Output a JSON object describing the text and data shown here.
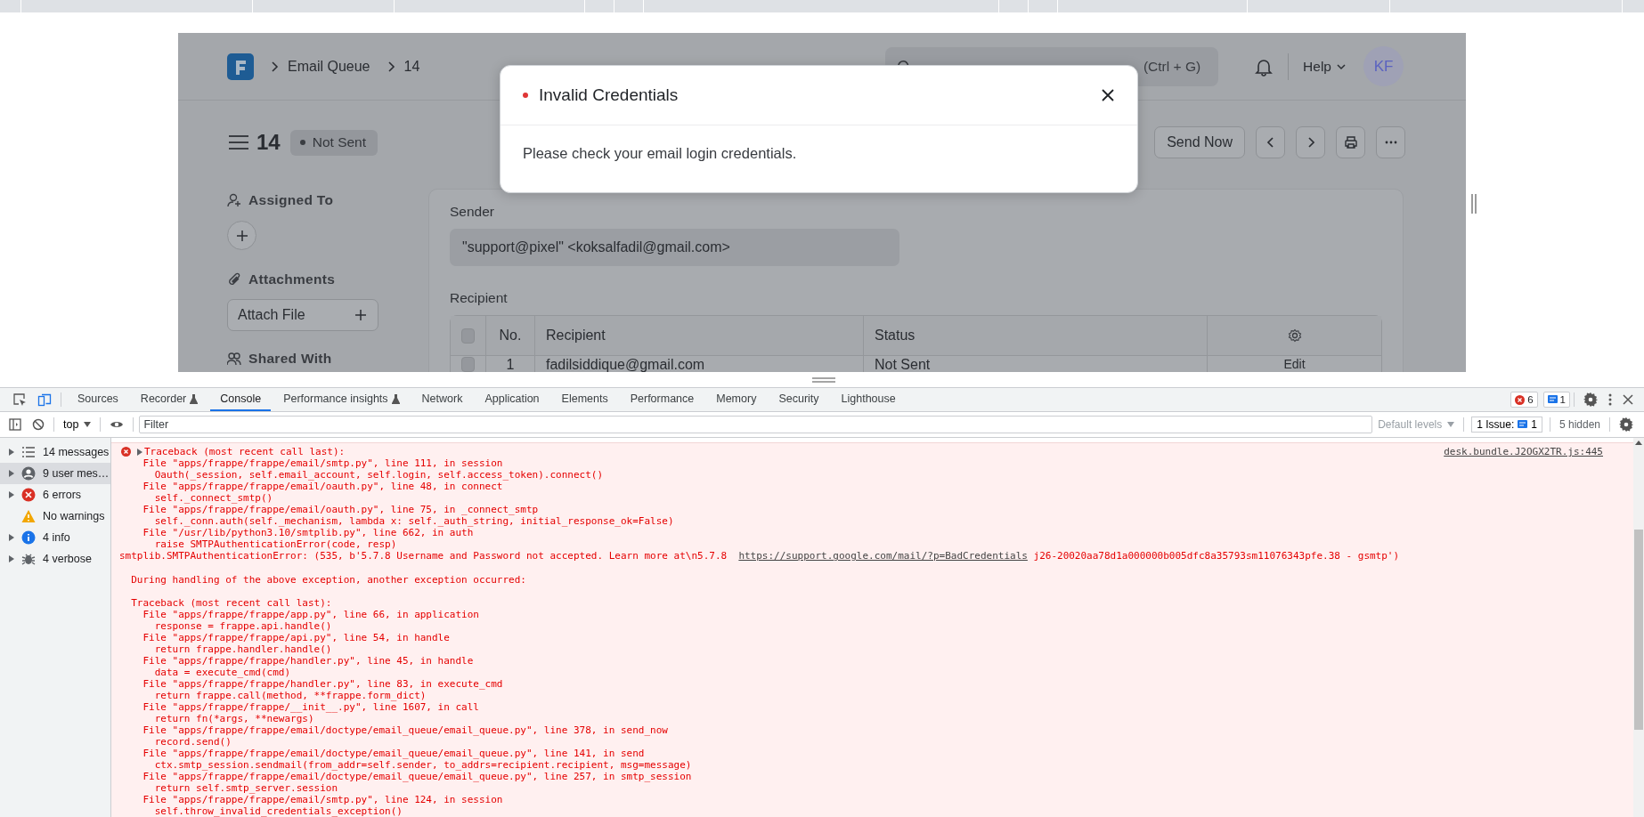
{
  "app": {
    "breadcrumbs": [
      "Email Queue",
      "14"
    ],
    "search": {
      "placeholder": "(Ctrl + G)"
    },
    "help": "Help",
    "avatar": "KF",
    "doc": {
      "title": "14",
      "status": "Not Sent"
    },
    "send_button": "Send Now",
    "sidebar": [
      {
        "kind": "assign",
        "label": "Assigned To"
      },
      {
        "kind": "attach",
        "label": "Attachments",
        "button": "Attach File"
      },
      {
        "kind": "share",
        "label": "Shared With"
      }
    ],
    "form": {
      "sender_label": "Sender",
      "sender_value": "\"support@pixel\" <koksalfadil@gmail.com>",
      "recipient_label": "Recipient",
      "table": {
        "select_all_checked": false,
        "columns": [
          "No.",
          "Recipient",
          "Status"
        ],
        "rows": [
          {
            "checked": false,
            "cells": [
              "1",
              "fadilsiddique@gmail.com",
              "Not Sent"
            ],
            "action": "Edit"
          }
        ]
      }
    }
  },
  "dialog": {
    "title": "Invalid Credentials",
    "message": "Please check your email login credentials."
  },
  "devtools": {
    "tabs": [
      {
        "label": "Sources",
        "selected": false,
        "experimental": false
      },
      {
        "label": "Recorder",
        "selected": false,
        "experimental": true
      },
      {
        "label": "Console",
        "selected": true,
        "experimental": false
      },
      {
        "label": "Performance insights",
        "selected": false,
        "experimental": true
      },
      {
        "label": "Network",
        "selected": false,
        "experimental": false
      },
      {
        "label": "Application",
        "selected": false,
        "experimental": false
      },
      {
        "label": "Elements",
        "selected": false,
        "experimental": false
      },
      {
        "label": "Performance",
        "selected": false,
        "experimental": false
      },
      {
        "label": "Memory",
        "selected": false,
        "experimental": false
      },
      {
        "label": "Security",
        "selected": false,
        "experimental": false
      },
      {
        "label": "Lighthouse",
        "selected": false,
        "experimental": false
      }
    ],
    "error_count": "6",
    "message_count": "1",
    "context": "top",
    "filter": {
      "placeholder": "Filter"
    },
    "levels": "Default levels",
    "issues": {
      "label": "1 Issue:",
      "count": "1"
    },
    "hidden": "5 hidden",
    "sidebar": [
      {
        "kind": "messages",
        "label": "14 messages",
        "selected": false
      },
      {
        "kind": "user",
        "label": "9 user mes…",
        "selected": true
      },
      {
        "kind": "errors",
        "label": "6 errors",
        "selected": false
      },
      {
        "kind": "warnings",
        "label": "No warnings",
        "selected": false
      },
      {
        "kind": "info",
        "label": "4 info",
        "selected": false
      },
      {
        "kind": "verbose",
        "label": "4 verbose",
        "selected": false
      }
    ],
    "message": {
      "source": "desk.bundle.J2OGX2TR.js:445",
      "sections": [
        [
          "Traceback (most recent call last):",
          "    File \"apps/frappe/frappe/email/smtp.py\", line 111, in session",
          "      Oauth(_session, self.email_account, self.login, self.access_token).connect()",
          "    File \"apps/frappe/frappe/email/oauth.py\", line 48, in connect",
          "      self._connect_smtp()",
          "    File \"apps/frappe/frappe/email/oauth.py\", line 75, in _connect_smtp",
          "      self._conn.auth(self._mechanism, lambda x: self._auth_string, initial_response_ok=False)",
          "    File \"/usr/lib/python3.10/smtplib.py\", line 662, in auth",
          "      raise SMTPAuthenticationError(code, resp)",
          {
            "text": "smtplib.SMTPAuthenticationError: (535, b'5.7.8 Username and Password not accepted. Learn more at\\n5.7.8  ",
            "link": "https://support.google.com/mail/?p=BadCredentials",
            "after": " j26-20020aa78d1a000000b005dfc8a35793sm11076343pfe.38 - gsmtp')"
          }
        ],
        [
          "  During handling of the above exception, another exception occurred:"
        ],
        [
          "  Traceback (most recent call last):",
          "    File \"apps/frappe/frappe/app.py\", line 66, in application",
          "      response = frappe.api.handle()",
          "    File \"apps/frappe/frappe/api.py\", line 54, in handle",
          "      return frappe.handler.handle()",
          "    File \"apps/frappe/frappe/handler.py\", line 45, in handle",
          "      data = execute_cmd(cmd)",
          "    File \"apps/frappe/frappe/handler.py\", line 83, in execute_cmd",
          "      return frappe.call(method, **frappe.form_dict)",
          "    File \"apps/frappe/frappe/__init__.py\", line 1607, in call",
          "      return fn(*args, **newargs)",
          "    File \"apps/frappe/frappe/email/doctype/email_queue/email_queue.py\", line 378, in send_now",
          "      record.send()",
          "    File \"apps/frappe/frappe/email/doctype/email_queue/email_queue.py\", line 141, in send",
          "      ctx.smtp_session.sendmail(from_addr=self.sender, to_addrs=recipient.recipient, msg=message)",
          "    File \"apps/frappe/frappe/email/doctype/email_queue/email_queue.py\", line 257, in smtp_session",
          "      return self.smtp_server.session",
          "    File \"apps/frappe/frappe/email/smtp.py\", line 124, in session",
          "      self.throw_invalid_credentials_exception()"
        ]
      ]
    }
  }
}
